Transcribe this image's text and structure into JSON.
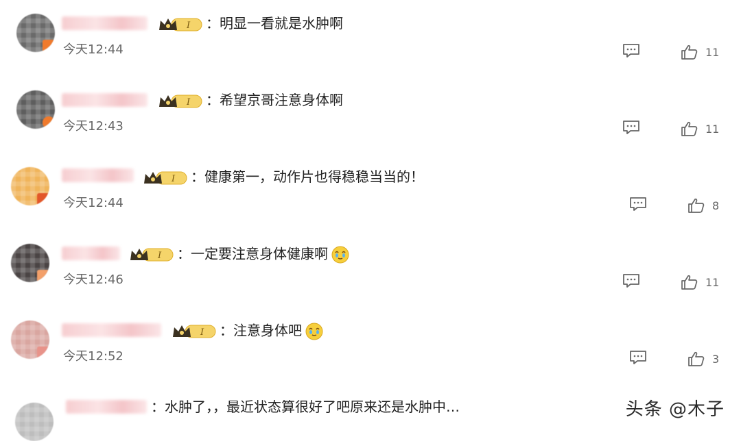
{
  "icons": {
    "crown": "crown-level-badge-icon",
    "comment": "comment-reply-icon",
    "like": "thumbs-up-icon",
    "emoji": "cute-face-emoji-icon"
  },
  "colors": {
    "crown_gold": "#f2c84b",
    "avatar_badge": "#f07a2c",
    "name_blur": "#f6c9cc"
  },
  "comments": [
    {
      "text": "：明显一看就是水肿啊",
      "time": "今天12:44",
      "likes": "11"
    },
    {
      "text": "：希望京哥注意身体啊",
      "time": "今天12:43",
      "likes": "11"
    },
    {
      "text": "：健康第一，动作片也得稳稳当当的！",
      "time": "今天12:44",
      "likes": "8"
    },
    {
      "text": "：一定要注意身体健康啊",
      "time": "今天12:46",
      "likes": "11"
    },
    {
      "text": "：注意身体吧",
      "time": "今天12:52",
      "likes": "3"
    },
    {
      "text": "：水肿了，，最近状态算很好了吧原来还是水肿中…",
      "time": "",
      "likes": ""
    }
  ],
  "crown_level": "I",
  "watermark": "头条 @木子"
}
